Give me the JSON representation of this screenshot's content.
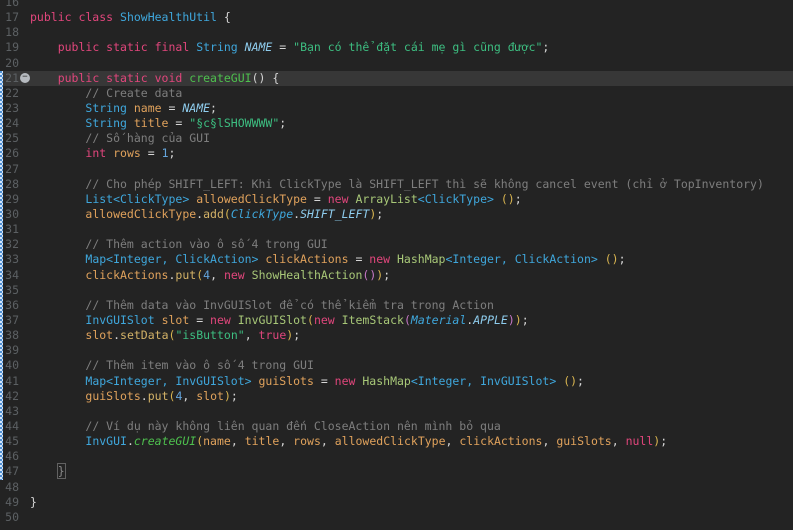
{
  "editor": {
    "colors": {
      "background": "#232323",
      "current_line_bg": "#373737",
      "line_number": "#5c6063",
      "change_bar_blue": "#4d8ed2",
      "change_bar_light": "#d4e4f6",
      "brace_box_border": "#616161"
    },
    "palette": {
      "kw": "#e1467c",
      "type": "#3fa7dc",
      "typei": "#3fa7dc",
      "consti": "#8fcdee",
      "ctor": "#a8c878",
      "mdecl": "#4ec04e",
      "mstatic": "#4ec04e",
      "meth": "#d3b267",
      "var": "#e0a25c",
      "str": "#3dbe81",
      "cm": "#7e7e7e",
      "num": "#64a5dc",
      "pl": "#d6d6d6",
      "p1": "#d9b550",
      "p2": "#c878c8",
      "dim": "#8a8a8a"
    },
    "highlight_line": 21,
    "fold_line": 21,
    "fold_icon_glyph": "−",
    "change_bar": {
      "from_line": 21,
      "to_line": 47
    },
    "lines": [
      {
        "n": 16,
        "t": []
      },
      {
        "n": 17,
        "t": [
          [
            "public class ",
            "kw"
          ],
          [
            "ShowHealthUtil",
            "type"
          ],
          [
            " {",
            "pl"
          ]
        ]
      },
      {
        "n": 18,
        "t": []
      },
      {
        "n": 19,
        "t": [
          [
            "    ",
            "pl"
          ],
          [
            "public static final ",
            "kw"
          ],
          [
            "String ",
            "type"
          ],
          [
            "NAME",
            "consti"
          ],
          [
            " = ",
            "pl"
          ],
          [
            "\"Bạn có thể đặt cái mẹ gì cũng được\"",
            "str"
          ],
          [
            ";",
            "pl"
          ]
        ]
      },
      {
        "n": 20,
        "t": []
      },
      {
        "n": 21,
        "t": [
          [
            "    ",
            "pl"
          ],
          [
            "public static void ",
            "kw"
          ],
          [
            "createGUI",
            "mdecl"
          ],
          [
            "() {",
            "pl"
          ]
        ]
      },
      {
        "n": 22,
        "t": [
          [
            "        ",
            "pl"
          ],
          [
            "// Create data",
            "cm"
          ]
        ]
      },
      {
        "n": 23,
        "t": [
          [
            "        ",
            "pl"
          ],
          [
            "String ",
            "type"
          ],
          [
            "name",
            "var"
          ],
          [
            " = ",
            "pl"
          ],
          [
            "NAME",
            "consti"
          ],
          [
            ";",
            "pl"
          ]
        ]
      },
      {
        "n": 24,
        "t": [
          [
            "        ",
            "pl"
          ],
          [
            "String ",
            "type"
          ],
          [
            "title",
            "var"
          ],
          [
            " = ",
            "pl"
          ],
          [
            "\"§c§lSHOWWWW\"",
            "str"
          ],
          [
            ";",
            "pl"
          ]
        ]
      },
      {
        "n": 25,
        "t": [
          [
            "        ",
            "pl"
          ],
          [
            "// Số hàng của GUI",
            "cm"
          ]
        ]
      },
      {
        "n": 26,
        "t": [
          [
            "        ",
            "pl"
          ],
          [
            "int ",
            "kw"
          ],
          [
            "rows",
            "var"
          ],
          [
            " = ",
            "pl"
          ],
          [
            "1",
            "num"
          ],
          [
            ";",
            "pl"
          ]
        ]
      },
      {
        "n": 27,
        "t": []
      },
      {
        "n": 28,
        "t": [
          [
            "        ",
            "pl"
          ],
          [
            "// Cho phép SHIFT_LEFT: Khi ClickType là SHIFT_LEFT thì sẽ không cancel event (chỉ ở TopInventory)",
            "cm"
          ]
        ]
      },
      {
        "n": 29,
        "t": [
          [
            "        ",
            "pl"
          ],
          [
            "List<ClickType>",
            "type"
          ],
          [
            " ",
            "pl"
          ],
          [
            "allowedClickType",
            "var"
          ],
          [
            " = ",
            "pl"
          ],
          [
            "new ",
            "kw"
          ],
          [
            "ArrayList",
            "ctor"
          ],
          [
            "<ClickType>",
            "type"
          ],
          [
            " ",
            "pl"
          ],
          [
            "()",
            "p1"
          ],
          [
            ";",
            "pl"
          ]
        ]
      },
      {
        "n": 30,
        "t": [
          [
            "        ",
            "pl"
          ],
          [
            "allowedClickType",
            "var"
          ],
          [
            ".",
            "pl"
          ],
          [
            "add",
            "meth"
          ],
          [
            "(",
            "p1"
          ],
          [
            "ClickType",
            "typei"
          ],
          [
            ".",
            "pl"
          ],
          [
            "SHIFT_LEFT",
            "consti"
          ],
          [
            ")",
            "p1"
          ],
          [
            ";",
            "pl"
          ]
        ]
      },
      {
        "n": 31,
        "t": []
      },
      {
        "n": 32,
        "t": [
          [
            "        ",
            "pl"
          ],
          [
            "// Thêm action vào ô số 4 trong GUI",
            "cm"
          ]
        ]
      },
      {
        "n": 33,
        "t": [
          [
            "        ",
            "pl"
          ],
          [
            "Map<Integer, ClickAction>",
            "type"
          ],
          [
            " ",
            "pl"
          ],
          [
            "clickActions",
            "var"
          ],
          [
            " = ",
            "pl"
          ],
          [
            "new ",
            "kw"
          ],
          [
            "HashMap",
            "ctor"
          ],
          [
            "<Integer, ClickAction>",
            "type"
          ],
          [
            " ",
            "pl"
          ],
          [
            "()",
            "p1"
          ],
          [
            ";",
            "pl"
          ]
        ]
      },
      {
        "n": 34,
        "t": [
          [
            "        ",
            "pl"
          ],
          [
            "clickActions",
            "var"
          ],
          [
            ".",
            "pl"
          ],
          [
            "put",
            "meth"
          ],
          [
            "(",
            "p1"
          ],
          [
            "4",
            "num"
          ],
          [
            ", ",
            "pl"
          ],
          [
            "new ",
            "kw"
          ],
          [
            "ShowHealthAction",
            "ctor"
          ],
          [
            "()",
            "p2"
          ],
          [
            ")",
            "p1"
          ],
          [
            ";",
            "pl"
          ]
        ]
      },
      {
        "n": 35,
        "t": []
      },
      {
        "n": 36,
        "t": [
          [
            "        ",
            "pl"
          ],
          [
            "// Thêm data vào InvGUISlot để có thể kiểm tra trong Action",
            "cm"
          ]
        ]
      },
      {
        "n": 37,
        "t": [
          [
            "        ",
            "pl"
          ],
          [
            "InvGUISlot ",
            "type"
          ],
          [
            "slot",
            "var"
          ],
          [
            " = ",
            "pl"
          ],
          [
            "new ",
            "kw"
          ],
          [
            "InvGUISlot",
            "ctor"
          ],
          [
            "(",
            "p1"
          ],
          [
            "new ",
            "kw"
          ],
          [
            "ItemStack",
            "ctor"
          ],
          [
            "(",
            "p2"
          ],
          [
            "Material",
            "typei"
          ],
          [
            ".",
            "pl"
          ],
          [
            "APPLE",
            "consti"
          ],
          [
            ")",
            "p2"
          ],
          [
            ")",
            "p1"
          ],
          [
            ";",
            "pl"
          ]
        ]
      },
      {
        "n": 38,
        "t": [
          [
            "        ",
            "pl"
          ],
          [
            "slot",
            "var"
          ],
          [
            ".",
            "pl"
          ],
          [
            "setData",
            "meth"
          ],
          [
            "(",
            "p1"
          ],
          [
            "\"isButton\"",
            "str"
          ],
          [
            ", ",
            "pl"
          ],
          [
            "true",
            "kw"
          ],
          [
            ")",
            "p1"
          ],
          [
            ";",
            "pl"
          ]
        ]
      },
      {
        "n": 39,
        "t": []
      },
      {
        "n": 40,
        "t": [
          [
            "        ",
            "pl"
          ],
          [
            "// Thêm item vào ô số 4 trong GUI",
            "cm"
          ]
        ]
      },
      {
        "n": 41,
        "t": [
          [
            "        ",
            "pl"
          ],
          [
            "Map<Integer, InvGUISlot>",
            "type"
          ],
          [
            " ",
            "pl"
          ],
          [
            "guiSlots",
            "var"
          ],
          [
            " = ",
            "pl"
          ],
          [
            "new ",
            "kw"
          ],
          [
            "HashMap",
            "ctor"
          ],
          [
            "<Integer, InvGUISlot>",
            "type"
          ],
          [
            " ",
            "pl"
          ],
          [
            "()",
            "p1"
          ],
          [
            ";",
            "pl"
          ]
        ]
      },
      {
        "n": 42,
        "t": [
          [
            "        ",
            "pl"
          ],
          [
            "guiSlots",
            "var"
          ],
          [
            ".",
            "pl"
          ],
          [
            "put",
            "meth"
          ],
          [
            "(",
            "p1"
          ],
          [
            "4",
            "num"
          ],
          [
            ", ",
            "pl"
          ],
          [
            "slot",
            "var"
          ],
          [
            ")",
            "p1"
          ],
          [
            ";",
            "pl"
          ]
        ]
      },
      {
        "n": 43,
        "t": []
      },
      {
        "n": 44,
        "t": [
          [
            "        ",
            "pl"
          ],
          [
            "// Ví dụ này không liên quan đến CloseAction nên mình bỏ qua",
            "cm"
          ]
        ]
      },
      {
        "n": 45,
        "t": [
          [
            "        ",
            "pl"
          ],
          [
            "InvGUI",
            "type"
          ],
          [
            ".",
            "pl"
          ],
          [
            "createGUI",
            "mstatic"
          ],
          [
            "(",
            "p1"
          ],
          [
            "name",
            "var"
          ],
          [
            ", ",
            "pl"
          ],
          [
            "title",
            "var"
          ],
          [
            ", ",
            "pl"
          ],
          [
            "rows",
            "var"
          ],
          [
            ", ",
            "pl"
          ],
          [
            "allowedClickType",
            "var"
          ],
          [
            ", ",
            "pl"
          ],
          [
            "clickActions",
            "var"
          ],
          [
            ", ",
            "pl"
          ],
          [
            "guiSlots",
            "var"
          ],
          [
            ", ",
            "pl"
          ],
          [
            "null",
            "kw"
          ],
          [
            ")",
            "p1"
          ],
          [
            ";",
            "pl"
          ]
        ]
      },
      {
        "n": 46,
        "t": []
      },
      {
        "n": 47,
        "t": [
          [
            "    ",
            "pl"
          ],
          [
            "}",
            "dim",
            "boxed"
          ]
        ]
      },
      {
        "n": 48,
        "t": []
      },
      {
        "n": 49,
        "t": [
          [
            "}",
            "pl"
          ]
        ]
      },
      {
        "n": 50,
        "t": []
      }
    ]
  }
}
